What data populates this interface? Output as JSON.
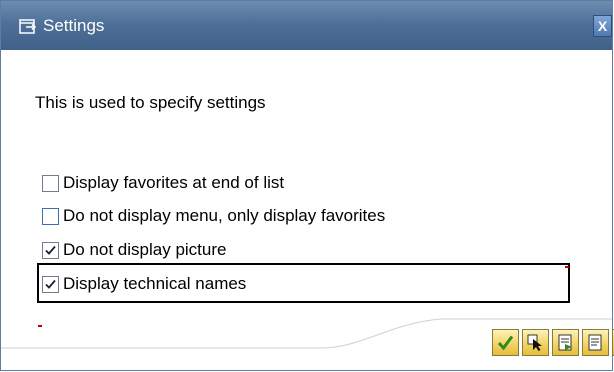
{
  "window": {
    "title": "Settings",
    "close_symbol": "X",
    "icon": "settings-window-icon"
  },
  "description": "This is used to specify settings",
  "options": [
    {
      "label": "Display favorites at end of list",
      "checked": false
    },
    {
      "label": "Do not display menu, only display favorites",
      "checked": false
    },
    {
      "label": "Do not display picture",
      "checked": true
    },
    {
      "label": "Display technical names",
      "checked": true
    }
  ],
  "toolbar": {
    "buttons": [
      "continue-check-icon",
      "select-cursor-icon",
      "save-settings-icon",
      "document-icon",
      "cancel-icon"
    ]
  },
  "colors": {
    "titlebar": "#4f7098",
    "highlight_border": "#000000",
    "accent_red": "#c00000",
    "button_yellow": "#f2d46a"
  }
}
